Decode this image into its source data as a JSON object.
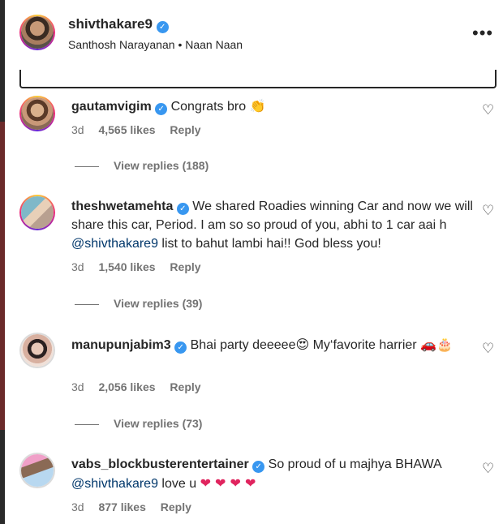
{
  "post": {
    "username": "shivthakare9",
    "audio_artist": "Santhosh Narayanan",
    "audio_separator": "•",
    "audio_title": "Naan Naan",
    "more_label": "•••"
  },
  "comments": [
    {
      "username": "gautamvigim",
      "text": "Congrats bro",
      "emoji": "👏",
      "age": "3d",
      "likes": "4,565 likes",
      "reply_label": "Reply",
      "view_replies": "View replies (188)"
    },
    {
      "username": "theshwetamehta",
      "text_1": "We shared Roadies winning Car and now we will share this car, Period. I am so so proud of you, abhi to 1 car aai h ",
      "mention": "@shivthakare9",
      "text_2": " list to bahut lambi hai!! God bless you!",
      "age": "3d",
      "likes": "1,540 likes",
      "reply_label": "Reply",
      "view_replies": "View replies (39)"
    },
    {
      "username": "manupunjabim3",
      "text_1": "Bhai party deeeee",
      "emoji_1": "😍",
      "text_2": " My‘favorite harrier ",
      "emoji_2": "🚗🎂",
      "age": "3d",
      "likes": "2,056 likes",
      "reply_label": "Reply",
      "view_replies": "View replies (73)"
    },
    {
      "username": "vabs_blockbusterentertainer",
      "text_1": "So proud of u majhya BHAWA ",
      "mention": "@shivthakare9",
      "text_2": " love u ",
      "hearts": "❤ ❤ ❤ ❤",
      "age": "3d",
      "likes": "877 likes",
      "reply_label": "Reply"
    }
  ],
  "icons": {
    "verified": "✓",
    "heart_outline": "♡"
  },
  "colors": {
    "verified_blue": "#3897f0",
    "mention_blue": "#00376b",
    "muted_text": "#737373",
    "heart_red": "#e0245e"
  }
}
